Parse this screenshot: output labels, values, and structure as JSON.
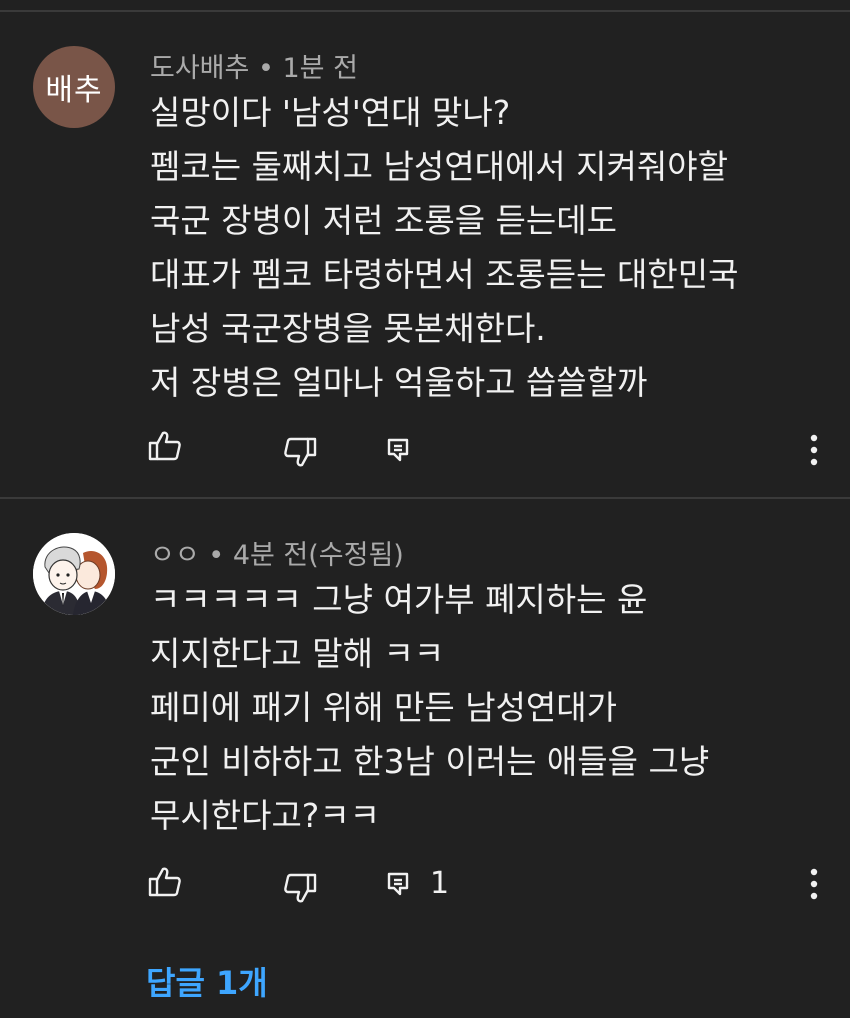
{
  "comments": [
    {
      "avatar_text": "배추",
      "author": "도사배추",
      "separator": "•",
      "time": "1분 전",
      "lines": [
        "실망이다 '남성'연대 맞나?",
        "펨코는 둘째치고 남성연대에서 지켜줘야할",
        "국군 장병이 저런 조롱을 듣는데도",
        "대표가 펨코 타령하면서 조롱듣는 대한민국",
        "남성 국군장병을 못본채한다.",
        "저 장병은 얼마나 억울하고 씁쓸할까"
      ],
      "reply_count": ""
    },
    {
      "avatar_text": "",
      "author": "ㅇㅇ",
      "separator": "•",
      "time": "4분 전(수정됨)",
      "lines": [
        "ㅋㅋㅋㅋㅋ 그냥 여가부 폐지하는 윤",
        "지지한다고 말해 ㅋㅋ",
        "페미에 패기 위해 만든 남성연대가",
        "군인 비하하고 한3남 이러는 애들을 그냥",
        "무시한다고?ㅋㅋ"
      ],
      "reply_count": "1"
    }
  ],
  "replies_link": "답글 1개",
  "icons": {
    "like": "thumbs-up-icon",
    "dislike": "thumbs-down-icon",
    "reply": "reply-comment-icon",
    "more": "more-vertical-icon"
  },
  "colors": {
    "background": "#212121",
    "link": "#3ea6ff",
    "avatar_bg": "#795548"
  }
}
